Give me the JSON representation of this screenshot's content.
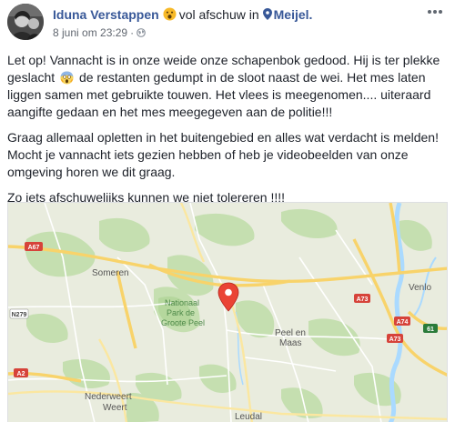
{
  "post": {
    "author": "Iduna Verstappen",
    "feeling_emoji": "frowning-face-emoji",
    "feeling": "vol afschuw in",
    "location_icon": "location-pin-icon",
    "location": "Meijel.",
    "timestamp": "8 juni om 23:29",
    "separator": "·",
    "privacy_icon": "globe-icon",
    "more_icon": "more-options-icon",
    "paragraphs": {
      "p1_before_emoji": "Let op! Vannacht is in onze weide onze schapenbok gedood. Hij is ter plekke geslacht",
      "p1_emoji": "face-screaming-in-fear-emoji",
      "p1_after_emoji": "de restanten gedumpt in de sloot naast de wei. Het mes laten liggen samen met gebruikte touwen. Het vlees is meegenomen.... uiteraard aangifte gedaan en het mes meegegeven aan de politie!!!",
      "p2": "Graag allemaal opletten in het buitengebied en alles wat verdacht is melden! Mocht je vannacht iets gezien hebben of heb je videobeelden van onze omgeving horen we dit graag.",
      "p3": "Zo iets afschuwelijks kunnen we niet tolereren !!!!"
    }
  },
  "map": {
    "places": {
      "someren": "Someren",
      "venlo": "Venlo",
      "np_line1": "Nationaal",
      "np_line2": "Park de",
      "np_line3": "Groote Peel",
      "peel_en_maas_1": "Peel en",
      "peel_en_maas_2": "Maas",
      "nederweert": "Nederweert",
      "weert": "Weert",
      "leudal": "Leudal"
    },
    "road_shields": {
      "a67": "A67",
      "n279": "N279",
      "a2": "A2",
      "a73a": "A73",
      "a73b": "A73",
      "a74": "A74",
      "e34": "61"
    },
    "colors": {
      "land": "#e9ecde",
      "forest": "#c5dfb0",
      "water": "#aadaff",
      "highway": "#f8d36a",
      "road": "#ffffff",
      "marker": "#ea4335"
    },
    "marker_icon": "map-marker-icon"
  }
}
